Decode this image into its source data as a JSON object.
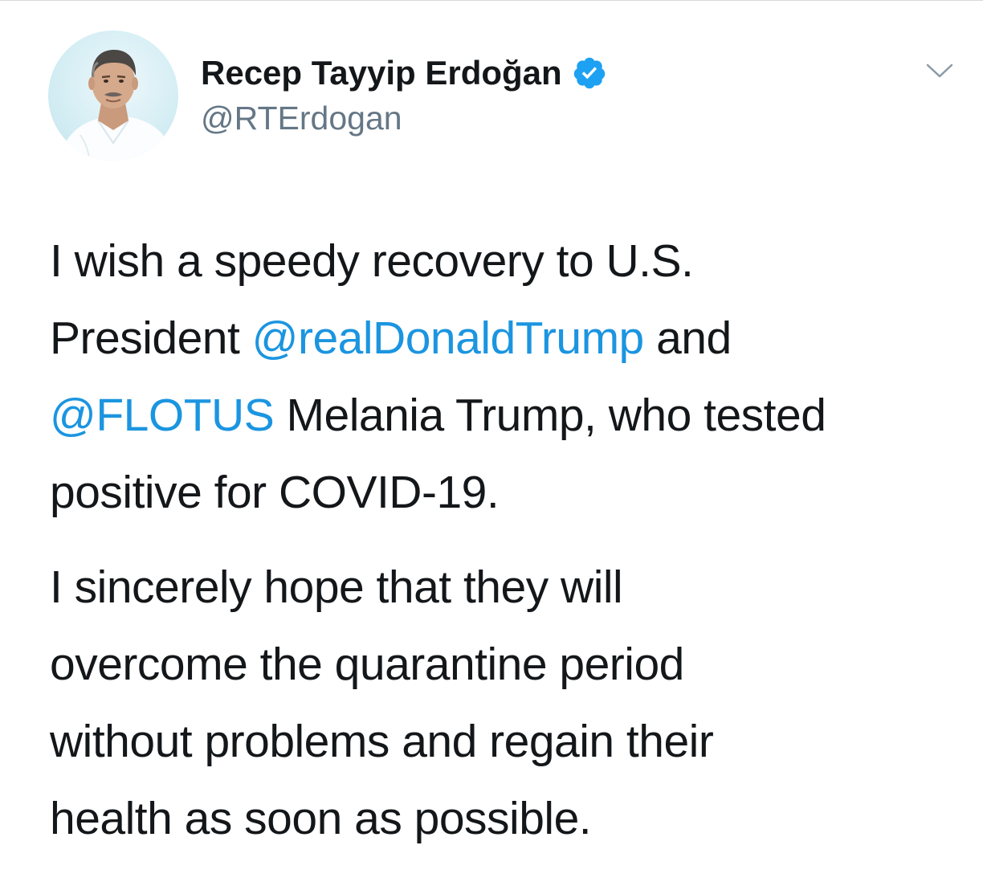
{
  "tweet": {
    "author": {
      "display_name": "Recep Tayyip Erdoğan",
      "handle": "@RTErdogan",
      "verified": true,
      "avatar_icon": "profile-photo"
    },
    "menu_icon": "chevron-down-icon",
    "paragraphs": [
      {
        "lines": [
          [
            {
              "text": "I wish a speedy recovery to U.S."
            }
          ],
          [
            {
              "text": "President "
            },
            {
              "text": "@realDonaldTrump",
              "mention": true
            },
            {
              "text": " and"
            }
          ],
          [
            {
              "text": "@FLOTUS",
              "mention": true
            },
            {
              "text": " Melania Trump, who tested"
            }
          ],
          [
            {
              "text": "positive for COVID-19."
            }
          ]
        ]
      },
      {
        "lines": [
          [
            {
              "text": "I sincerely hope that they will"
            }
          ],
          [
            {
              "text": "overcome the quarantine period"
            }
          ],
          [
            {
              "text": "without problems and regain their"
            }
          ],
          [
            {
              "text": "health as soon as possible."
            }
          ]
        ]
      }
    ]
  },
  "colors": {
    "text": "#14171a",
    "secondary": "#657786",
    "link": "#1b95e0",
    "verified_badge": "#1da1f2",
    "background": "#ffffff"
  }
}
